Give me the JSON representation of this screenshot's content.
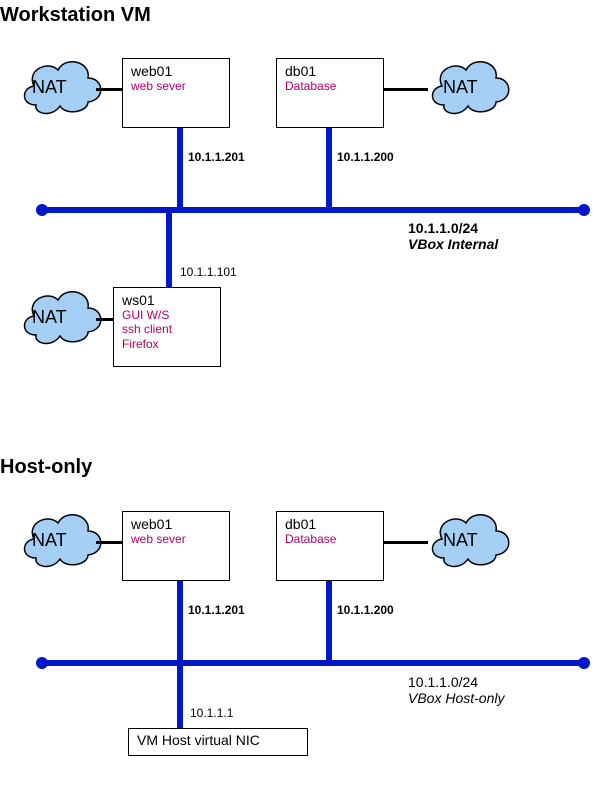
{
  "section1": {
    "title": "Workstation VM",
    "nat_label": "NAT",
    "web01": {
      "name": "web01",
      "desc": "web sever",
      "ip": "10.1.1.201"
    },
    "db01": {
      "name": "db01",
      "desc": "Database",
      "ip": "10.1.1.200"
    },
    "ws01": {
      "name": "ws01",
      "desc1": "GUI W/S",
      "desc2": "ssh client",
      "desc3": "Firefox",
      "ip": "10.1.1.101"
    },
    "network": {
      "cidr": "10.1.1.0/24",
      "type": "VBox Internal"
    }
  },
  "section2": {
    "title": "Host-only",
    "nat_label": "NAT",
    "web01": {
      "name": "web01",
      "desc": "web sever",
      "ip": "10.1.1.201"
    },
    "db01": {
      "name": "db01",
      "desc": "Database",
      "ip": "10.1.1.200"
    },
    "hostnic": {
      "label": "VM Host virtual NIC",
      "ip": "10.1.1.1"
    },
    "network": {
      "cidr": "10.1.1.0/24",
      "type": "VBox Host-only"
    }
  }
}
